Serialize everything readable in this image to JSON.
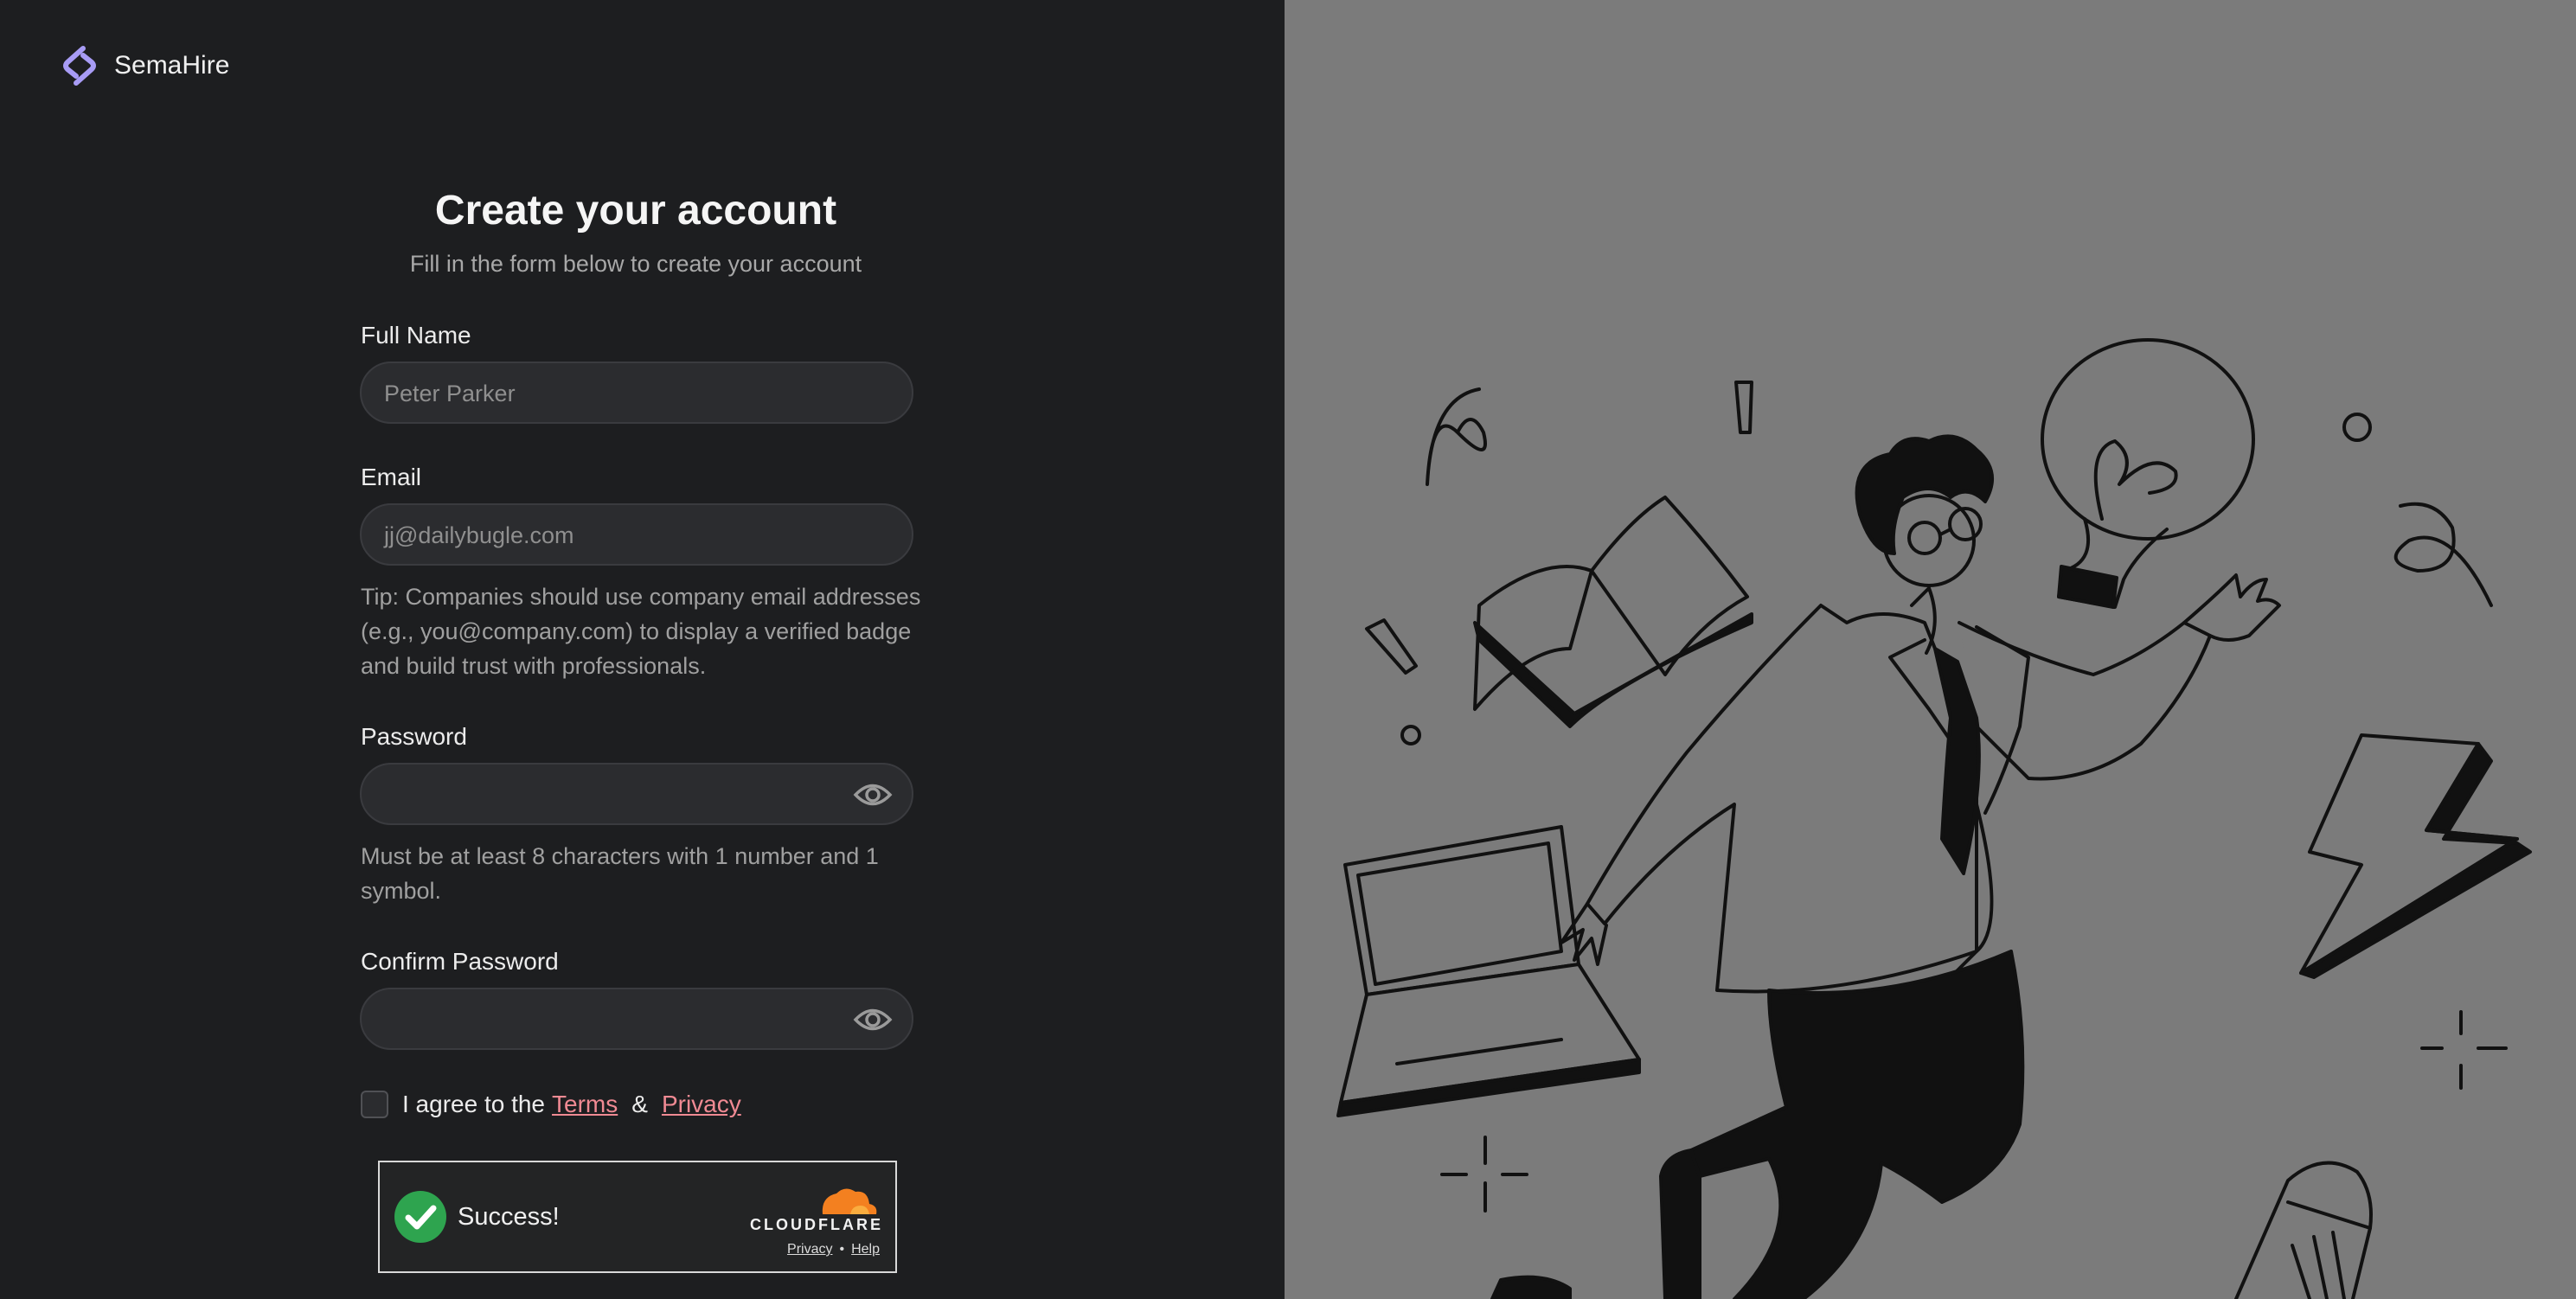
{
  "brand": {
    "name": "SemaHire",
    "accent": "#a89cf5"
  },
  "header": {
    "title": "Create your account",
    "subtitle": "Fill in the form below to create your account"
  },
  "form": {
    "full_name": {
      "label": "Full Name",
      "placeholder": "Peter Parker"
    },
    "email": {
      "label": "Email",
      "placeholder": "jj@dailybugle.com",
      "tip_line1": "Tip: Companies should use company email addresses",
      "tip_line2": "(e.g., you@company.com) to display a verified badge",
      "tip_line3": "and build trust with professionals."
    },
    "password": {
      "label": "Password",
      "hint_line1": "Must be at least 8 characters with 1 number and 1",
      "hint_line2": "symbol.",
      "toggle_icon": "eye-icon"
    },
    "confirm_password": {
      "label": "Confirm Password",
      "toggle_icon": "eye-icon"
    },
    "agree": {
      "prefix": "I agree to the",
      "terms": "Terms",
      "amp": "&",
      "privacy": "Privacy",
      "checked": false
    }
  },
  "captcha": {
    "status": "Success!",
    "provider": "CLOUDFLARE",
    "privacy": "Privacy",
    "separator": "•",
    "help": "Help",
    "success_color": "#2ea44f",
    "provider_color": "#f38020"
  },
  "colors": {
    "left_bg": "#1d1e20",
    "right_bg": "#7b7b7b",
    "link": "#f08a93"
  }
}
